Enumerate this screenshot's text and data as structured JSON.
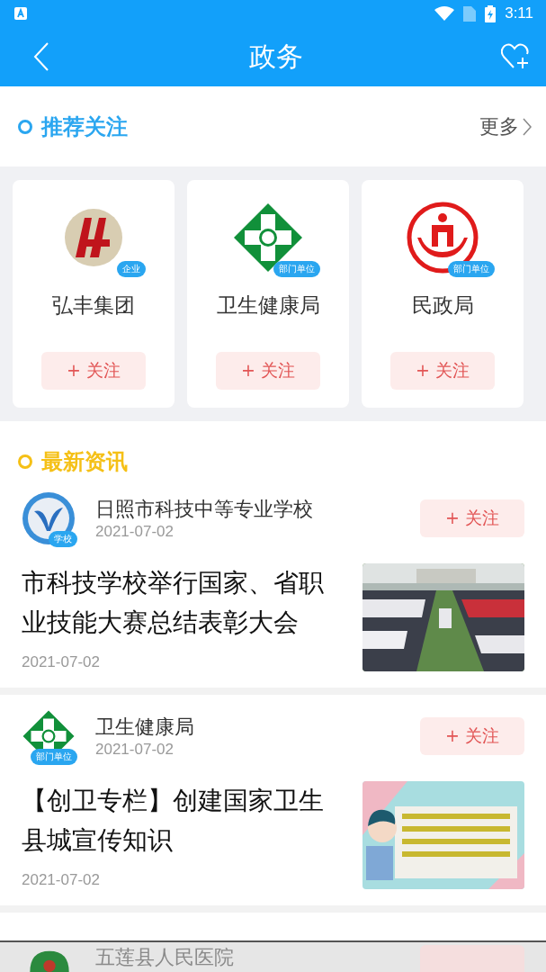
{
  "status_bar": {
    "time": "3:11"
  },
  "header": {
    "title": "政务"
  },
  "recommend": {
    "title": "推荐关注",
    "more": "更多",
    "cards": [
      {
        "kind": "company",
        "name": "弘丰集团",
        "badge": "企业",
        "follow": "+ 关注"
      },
      {
        "kind": "health",
        "name": "卫生健康局",
        "badge": "部门单位",
        "follow": "+ 关注"
      },
      {
        "kind": "civil",
        "name": "民政局",
        "badge": "部门单位",
        "follow": "+ 关注"
      }
    ]
  },
  "news": {
    "title": "最新资讯",
    "items": [
      {
        "kind": "school",
        "source": "日照市科技中等专业学校",
        "badge": "学校",
        "source_date": "2021-07-02",
        "follow": "+ 关注",
        "headline": "市科技学校举行国家、省职业技能大赛总结表彰大会",
        "date": "2021-07-02"
      },
      {
        "kind": "health",
        "source": "卫生健康局",
        "badge": "部门单位",
        "source_date": "2021-07-02",
        "follow": "+ 关注",
        "headline": "【创卫专栏】创建国家卫生县城宣传知识",
        "date": "2021-07-02"
      }
    ],
    "partial": {
      "source": "五莲县人民医院"
    }
  }
}
